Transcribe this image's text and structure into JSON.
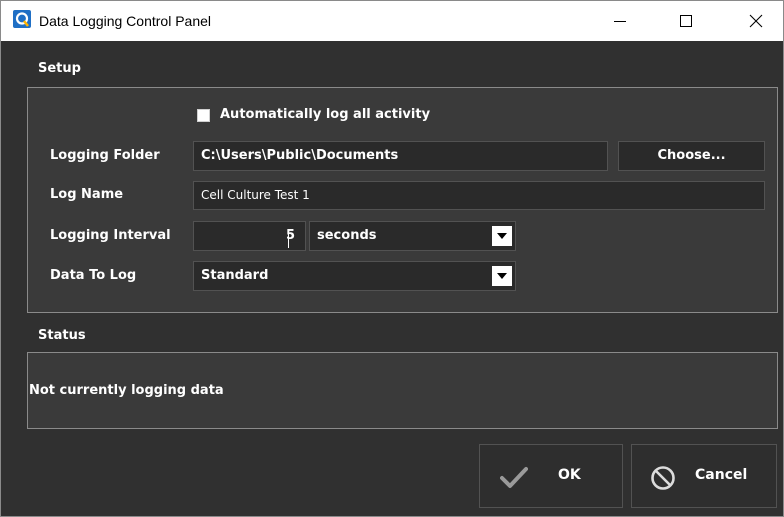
{
  "window": {
    "title": "Data Logging Control Panel",
    "icon": "app-logo-icon",
    "controls": [
      "minimize-icon",
      "maximize-icon",
      "close-icon"
    ]
  },
  "setup": {
    "section_label": "Setup",
    "auto_log": {
      "label": "Automatically log all activity",
      "checked": false
    },
    "logging_folder": {
      "label": "Logging Folder",
      "value": "C:\\Users\\Public\\Documents",
      "button_label": "Choose..."
    },
    "log_name": {
      "label": "Log Name",
      "value": "Cell Culture Test 1"
    },
    "logging_interval": {
      "label": "Logging Interval",
      "value": "5",
      "unit": "seconds"
    },
    "data_to_log": {
      "label": "Data To Log",
      "value": "Standard"
    }
  },
  "status": {
    "section_label": "Status",
    "message": "Not currently logging data"
  },
  "buttons": {
    "ok_label": "OK",
    "cancel_label": "Cancel"
  },
  "colors": {
    "background": "#303030",
    "panel": "#3a3a3a",
    "field": "#2a2a2a",
    "border": "#8a8a8a",
    "text": "#ffffff"
  }
}
